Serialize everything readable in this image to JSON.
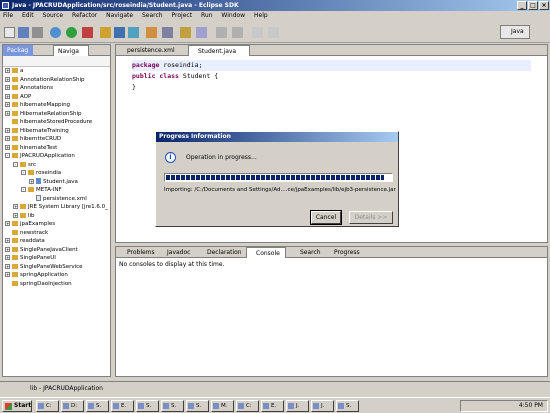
{
  "window": {
    "title": "Java - JPACRUDApplication/src/roseindia/Student.java - Eclipse SDK"
  },
  "menu": [
    "File",
    "Edit",
    "Source",
    "Refactor",
    "Navigate",
    "Search",
    "Project",
    "Run",
    "Window",
    "Help"
  ],
  "perspective": {
    "label": "Java"
  },
  "explorer": {
    "tabs": [
      "Packag",
      "Naviga"
    ],
    "tree": [
      {
        "label": "a",
        "type": "project",
        "depth": 0,
        "ex": "+"
      },
      {
        "label": "AnnotationRelationShip",
        "type": "project",
        "depth": 0,
        "ex": "+"
      },
      {
        "label": "Annotations",
        "type": "project",
        "depth": 0,
        "ex": "+"
      },
      {
        "label": "AOP",
        "type": "project",
        "depth": 0,
        "ex": "+"
      },
      {
        "label": "hibernateMapping",
        "type": "project",
        "depth": 0,
        "ex": "+"
      },
      {
        "label": "HibernateRelationShip",
        "type": "project",
        "depth": 0,
        "ex": "+"
      },
      {
        "label": "hibernateStoredProcedure",
        "type": "project",
        "depth": 0,
        "ex": ""
      },
      {
        "label": "HibernateTraining",
        "type": "project",
        "depth": 0,
        "ex": "+"
      },
      {
        "label": "hiberntteCRUD",
        "type": "project",
        "depth": 0,
        "ex": "+"
      },
      {
        "label": "hinernateTest",
        "type": "project",
        "depth": 0,
        "ex": "+"
      },
      {
        "label": "JPACRUDApplication",
        "type": "project",
        "depth": 0,
        "ex": "-"
      },
      {
        "label": "src",
        "type": "folder",
        "depth": 1,
        "ex": "-"
      },
      {
        "label": "roseindia",
        "type": "package",
        "depth": 2,
        "ex": "-"
      },
      {
        "label": "Student.java",
        "type": "java",
        "depth": 3,
        "ex": "+"
      },
      {
        "label": "META-INF",
        "type": "folder",
        "depth": 2,
        "ex": "-"
      },
      {
        "label": "persistence.xml",
        "type": "file",
        "depth": 3,
        "ex": ""
      },
      {
        "label": "JRE System Library [jre1.6.0_",
        "type": "folder",
        "depth": 1,
        "ex": "+"
      },
      {
        "label": "lib",
        "type": "folder",
        "depth": 1,
        "ex": "+"
      },
      {
        "label": "jpaExamples",
        "type": "project",
        "depth": 0,
        "ex": "+"
      },
      {
        "label": "newstrack",
        "type": "project",
        "depth": 0,
        "ex": ""
      },
      {
        "label": "readdata",
        "type": "project",
        "depth": 0,
        "ex": "+"
      },
      {
        "label": "SinglePaneJavaClient",
        "type": "project",
        "depth": 0,
        "ex": "+"
      },
      {
        "label": "SinglePaneUI",
        "type": "project",
        "depth": 0,
        "ex": "+"
      },
      {
        "label": "SinglePaneWebService",
        "type": "project",
        "depth": 0,
        "ex": "+"
      },
      {
        "label": "springApplication",
        "type": "project",
        "depth": 0,
        "ex": "+"
      },
      {
        "label": "springDaoInjection",
        "type": "project",
        "depth": 0,
        "ex": ""
      }
    ]
  },
  "editor": {
    "tabs": [
      "persistence.xml",
      "Student.java"
    ],
    "lines": [
      {
        "kw": "package",
        "rest": " roseindia;"
      },
      {
        "kw": "public class",
        "rest": " Student {"
      },
      {
        "kw": "",
        "rest": "}"
      }
    ]
  },
  "bottom": {
    "tabs": [
      "Problems",
      "Javadoc",
      "Declaration",
      "Console",
      "Search",
      "Progress"
    ],
    "message": "No consoles to display at this time."
  },
  "dialog": {
    "title": "Progress Information",
    "message": "Operation in progress...",
    "progress": 0.97,
    "importing": "Importing: /C:/Documents and Settings/Ad....ce/jpaExamples/lib/ejb3-persistence.jar",
    "cancel": "Cancel",
    "details": "Details >>"
  },
  "status": {
    "text": "lib - JPACRUDApplication"
  },
  "taskbar": {
    "start": "Start",
    "items": [
      "C:",
      "D:",
      "S.",
      "E.",
      "S.",
      "S.",
      "S.",
      "M.",
      "C:",
      "E.",
      "J.",
      "J.",
      "S."
    ],
    "clock": "4:50 PM"
  },
  "colors": {
    "title": "#0a246a",
    "keyword": "#7f0055",
    "progress": "#0a246a"
  }
}
